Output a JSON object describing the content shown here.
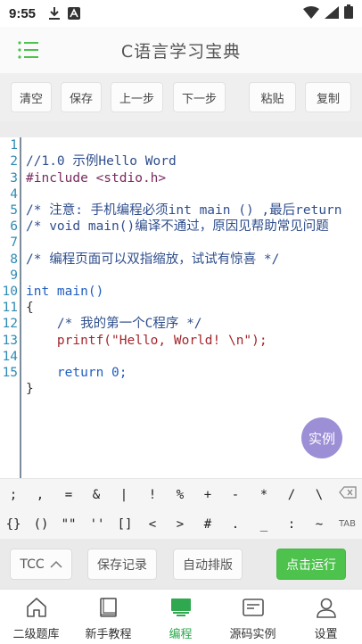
{
  "status": {
    "time": "9:55"
  },
  "header": {
    "title": "C语言学习宝典",
    "menu_icon": "list-menu-icon"
  },
  "toolbar": {
    "clear": "清空",
    "save": "保存",
    "undo": "上一步",
    "redo": "下一步",
    "paste": "粘贴",
    "copy": "复制"
  },
  "editor": {
    "current_line": 1,
    "line_numbers": [
      "1",
      "2",
      "3",
      "4",
      "5",
      "6",
      "7",
      "8",
      "9",
      "10",
      "11",
      "12",
      "13",
      "14",
      "15"
    ],
    "lines": [
      "//1.0 示例Hello Word",
      "#include <stdio.h>",
      "",
      "/* 注意: 手机编程必须int main () ,最后return",
      "/* void main()编译不通过，原因见帮助常见问题",
      "",
      "/* 编程页面可以双指缩放，试试有惊喜 */",
      "",
      "int main()",
      "{",
      "    /* 我的第一个C程序 */",
      "    printf(\"Hello, World! \\n\");",
      "",
      "    return 0;",
      "}"
    ]
  },
  "example_button": "实例",
  "symbols": {
    "row1": [
      ";",
      ",",
      "=",
      "&",
      "|",
      "!",
      "%",
      "+",
      "-",
      "*",
      "/",
      "\\"
    ],
    "row2": [
      "{}",
      "()",
      "\"\"",
      "''",
      "[]",
      "<",
      ">",
      "#",
      ".",
      "_",
      ":",
      "~",
      "TAB"
    ]
  },
  "actions": {
    "compiler": "TCC",
    "history": "保存记录",
    "format": "自动排版",
    "run": "点击运行"
  },
  "nav": {
    "items": [
      {
        "label": "二级题库",
        "icon": "home-icon"
      },
      {
        "label": "新手教程",
        "icon": "book-icon"
      },
      {
        "label": "编程",
        "icon": "monitor-icon"
      },
      {
        "label": "源码实例",
        "icon": "code-card-icon"
      },
      {
        "label": "设置",
        "icon": "person-icon"
      }
    ],
    "active_index": 2
  },
  "colors": {
    "accent_green": "#4dc24d",
    "nav_active": "#2fa84f",
    "fab": "#9c8fd6",
    "line_number": "#2e8bb5"
  }
}
